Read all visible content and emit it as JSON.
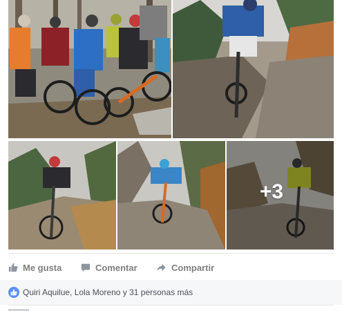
{
  "photos": {
    "more_count": "+3",
    "grid": [
      {
        "id": "photo-1"
      },
      {
        "id": "photo-2"
      },
      {
        "id": "photo-3"
      },
      {
        "id": "photo-4"
      },
      {
        "id": "photo-5"
      }
    ]
  },
  "actions": {
    "like_label": "Me gusta",
    "comment_label": "Comentar",
    "share_label": "Compartir",
    "like_icon": "thumbs-up-icon",
    "comment_icon": "speech-bubble-icon",
    "share_icon": "share-arrow-icon"
  },
  "reactions": {
    "summary": "Quiri Aquilue, Lola Moreno y 31 personas más",
    "icon": "like-badge-icon"
  },
  "colors": {
    "action_text": "#7f7f7f",
    "like_badge": "#5890ff",
    "reactions_bg": "#f6f7f9",
    "reactions_text": "#4b4f56"
  }
}
